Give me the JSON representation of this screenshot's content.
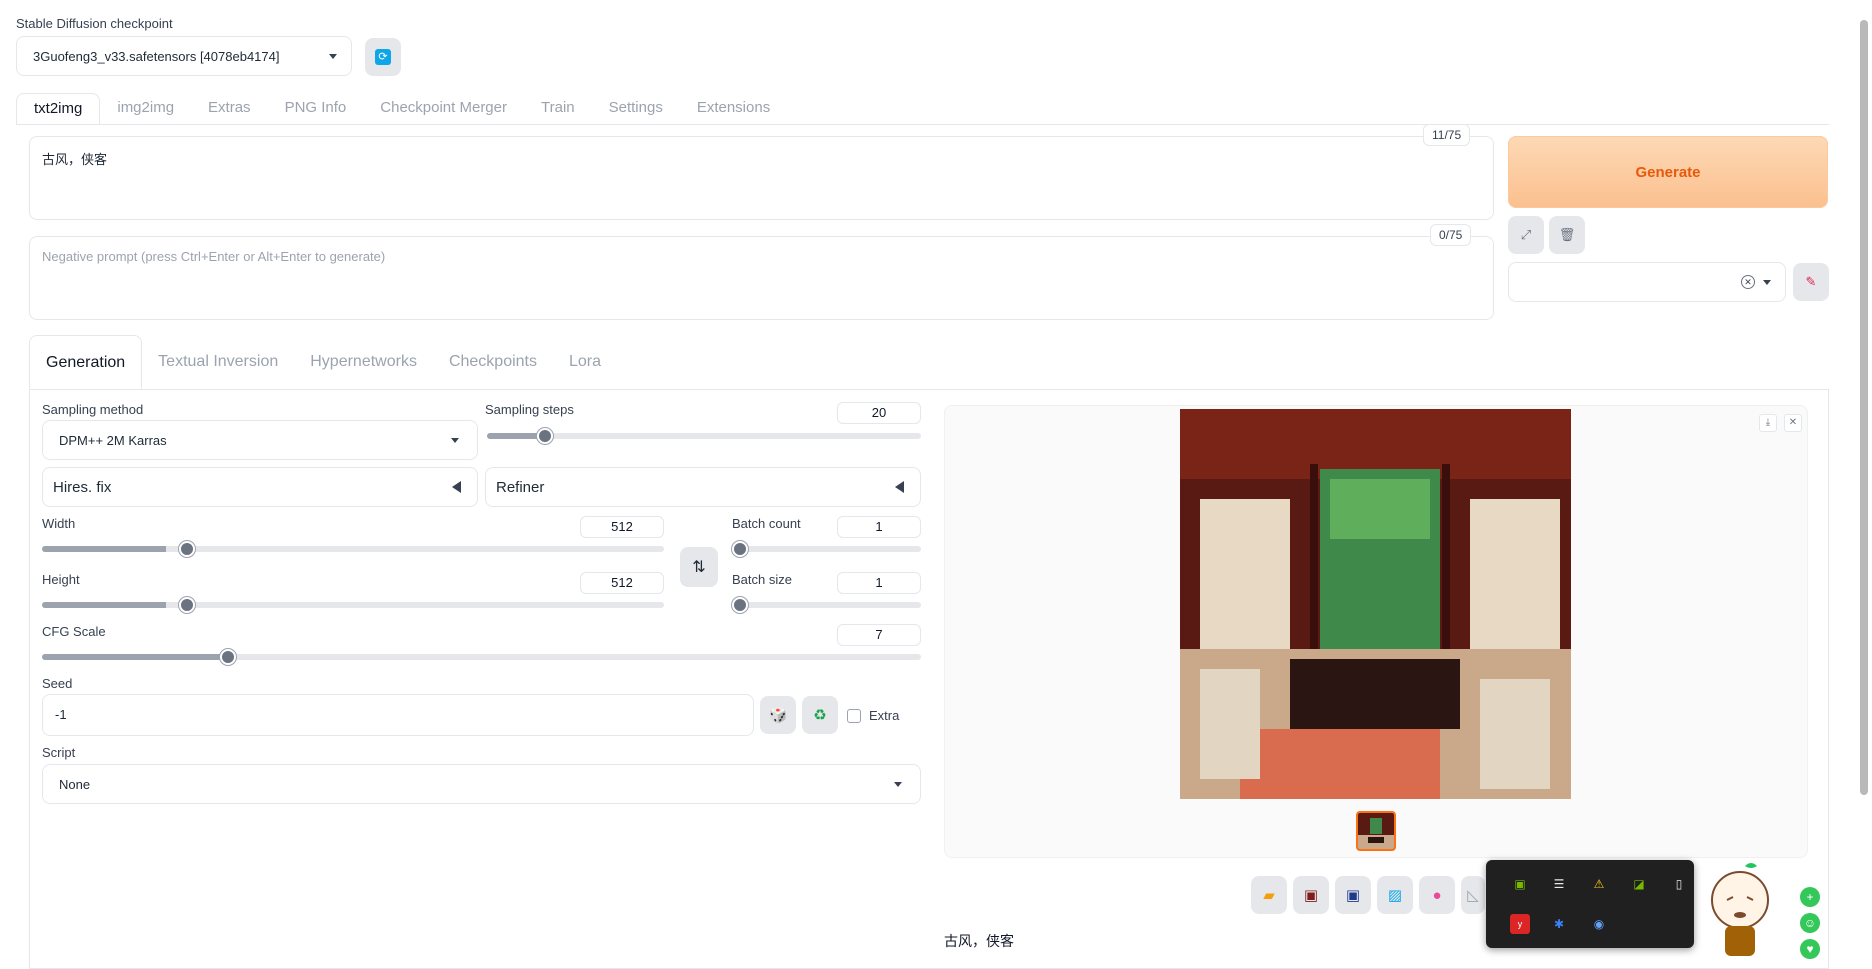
{
  "checkpoint": {
    "label": "Stable Diffusion checkpoint",
    "value": "3Guofeng3_v33.safetensors [4078eb4174]"
  },
  "tabs": [
    "txt2img",
    "img2img",
    "Extras",
    "PNG Info",
    "Checkpoint Merger",
    "Train",
    "Settings",
    "Extensions"
  ],
  "prompt": {
    "value": "古风，侠客",
    "counter": "11/75"
  },
  "negative_prompt": {
    "placeholder": "Negative prompt (press Ctrl+Enter or Alt+Enter to generate)",
    "counter": "0/75"
  },
  "generate_label": "Generate",
  "subtabs": [
    "Generation",
    "Textual Inversion",
    "Hypernetworks",
    "Checkpoints",
    "Lora"
  ],
  "sampling": {
    "method_label": "Sampling method",
    "method_value": "DPM++ 2M Karras",
    "steps_label": "Sampling steps",
    "steps_value": "20"
  },
  "hires_label": "Hires. fix",
  "refiner_label": "Refiner",
  "width": {
    "label": "Width",
    "value": "512"
  },
  "height": {
    "label": "Height",
    "value": "512"
  },
  "batch_count": {
    "label": "Batch count",
    "value": "1"
  },
  "batch_size": {
    "label": "Batch size",
    "value": "1"
  },
  "cfg": {
    "label": "CFG Scale",
    "value": "7"
  },
  "seed": {
    "label": "Seed",
    "value": "-1",
    "extra_label": "Extra"
  },
  "script": {
    "label": "Script",
    "value": "None"
  },
  "output_caption": "古风，侠客",
  "colors": {
    "generate_text": "#e8590c",
    "accent_orange": "#f97316"
  }
}
